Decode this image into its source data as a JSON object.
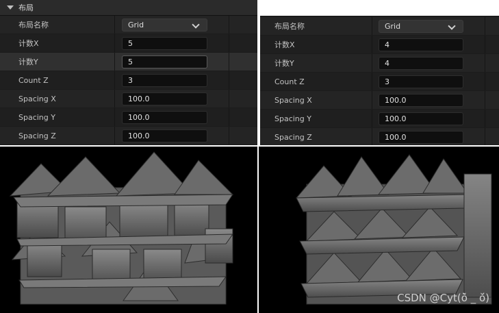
{
  "left_panel": {
    "section_title": "布局",
    "rows": [
      {
        "label": "布局名称",
        "value": "Grid",
        "type": "dropdown"
      },
      {
        "label": "计数X",
        "value": "5"
      },
      {
        "label": "计数Y",
        "value": "5"
      },
      {
        "label": "Count Z",
        "value": "3"
      },
      {
        "label": "Spacing X",
        "value": "100.0"
      },
      {
        "label": "Spacing Y",
        "value": "100.0"
      },
      {
        "label": "Spacing Z",
        "value": "100.0"
      }
    ]
  },
  "right_panel": {
    "rows": [
      {
        "label": "布局名称",
        "value": "Grid",
        "type": "dropdown"
      },
      {
        "label": "计数X",
        "value": "4"
      },
      {
        "label": "计数Y",
        "value": "4"
      },
      {
        "label": "Count Z",
        "value": "3"
      },
      {
        "label": "Spacing X",
        "value": "100.0"
      },
      {
        "label": "Spacing Y",
        "value": "100.0"
      },
      {
        "label": "Spacing Z",
        "value": "100.0"
      }
    ]
  },
  "viewports": {
    "left": {
      "grid": "5x5x3"
    },
    "right": {
      "grid": "4x4x3"
    }
  },
  "watermark": "CSDN @Cyt(ŏ̀ _ ŏ́)",
  "colors": {
    "panel_bg": "#1a1a1a",
    "field_bg": "#0f0f0f",
    "mesh": "#6e6e6e",
    "viewport_bg": "#000000"
  }
}
